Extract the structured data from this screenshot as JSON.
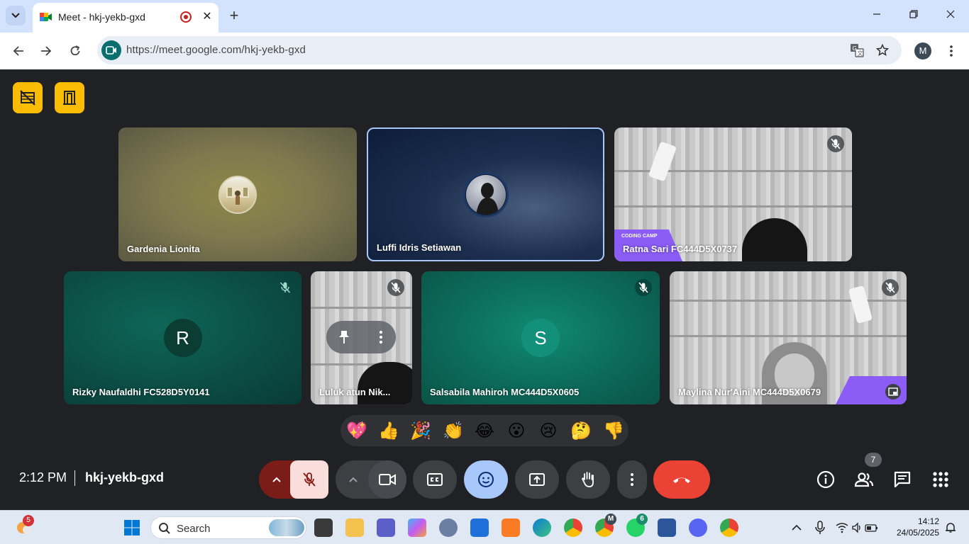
{
  "browser": {
    "tab_title": "Meet - hkj-yekb-gxd",
    "tab_close": "✕",
    "new_tab": "+",
    "url": "https://meet.google.com/hkj-yekb-gxd",
    "profile_initial": "M"
  },
  "meet": {
    "time": "2:12 PM",
    "meeting_code": "hkj-yekb-gxd",
    "participant_count": "7",
    "participants": [
      {
        "name": "Gardenia Lionita"
      },
      {
        "name": "Luffi Idris Setiawan"
      },
      {
        "name": "Ratna Sari FC444D5X0737",
        "overlay_text": "CODING CAMP"
      },
      {
        "name": "Rizky Naufaldhi FC528D5Y0141",
        "initial": "R"
      },
      {
        "name": "Luluk atun Nik..."
      },
      {
        "name": "Salsabila Mahiroh MC444D5X0605",
        "initial": "S"
      },
      {
        "name": "Maylina Nur'Aini MC444D5X0679"
      }
    ],
    "reactions": [
      "💖",
      "👍",
      "🎉",
      "👏",
      "😂",
      "😮",
      "😢",
      "🤔",
      "👎"
    ]
  },
  "taskbar": {
    "search_placeholder": "Search",
    "widget_badge": "5",
    "whatsapp_badge": "6",
    "chrome_profile_badge": "M",
    "clock_time": "14:12",
    "clock_date": "24/05/2025"
  },
  "colors": {
    "meet_bg": "#202124",
    "accent_yellow": "#fbbc04",
    "end_call_red": "#ea4335",
    "active_blue": "#a8c7fa",
    "mic_off_bg": "#f9dedc"
  }
}
